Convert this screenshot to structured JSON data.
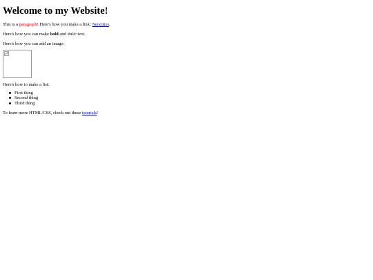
{
  "heading": "Welcome to my Website!",
  "para1": {
    "prefix": "This is a ",
    "red_word": "paragraph!",
    "middle": " Here's how you make a link: ",
    "link": "Neocities",
    "suffix": "."
  },
  "para2": {
    "prefix": "Here's how you can make ",
    "bold": "bold",
    "middle": " and ",
    "italic": "italic",
    "suffix": " text."
  },
  "para3": "Here's how you can add an image:",
  "para4": "Here's how to make a list:",
  "list": [
    "First thing",
    "Second thing",
    "Third thing"
  ],
  "para5": {
    "prefix": "To learn more HTML/CSS, check out these ",
    "link": "tutorials",
    "suffix": "!"
  },
  "colors": {
    "text": "#000000",
    "accent_red": "#ff0000",
    "link": "#0000ee"
  },
  "icons": {
    "image_placeholder": "broken-image-icon"
  }
}
